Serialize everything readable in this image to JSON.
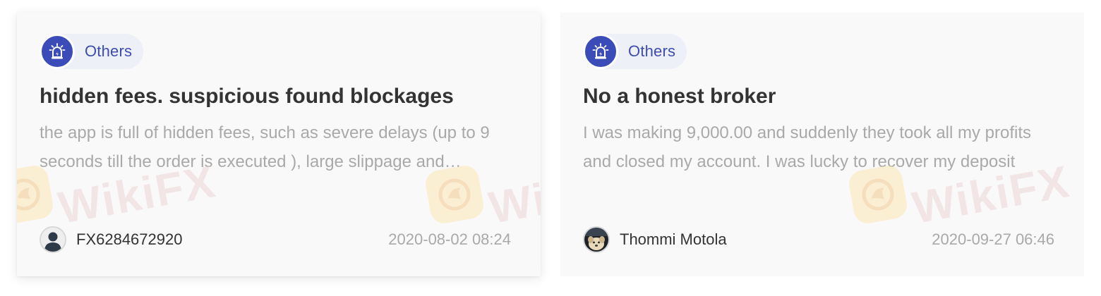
{
  "reviews": [
    {
      "category": "Others",
      "category_icon": "alert-siren-icon",
      "title": "hidden fees. suspicious found blockages",
      "excerpt": "the app is full of hidden fees, such as severe delays (up to 9 seconds till the order is executed ), large slippage and suspicious blockages",
      "author": "FX6284672920",
      "avatar": "default-user-avatar",
      "timestamp": "2020-08-02 08:24"
    },
    {
      "category": "Others",
      "category_icon": "alert-siren-icon",
      "title": "No a honest broker",
      "excerpt": "I was making 9,000.00 and suddenly they took all my profits and closed my account. I was lucky to recover my deposit",
      "author": "Thommi Motola",
      "avatar": "dog-photo-avatar",
      "timestamp": "2020-09-27 06:46"
    }
  ],
  "watermark": {
    "text": "WikiFX"
  },
  "colors": {
    "accent": "#3b4bb8",
    "tag_background": "#eef0f8",
    "title": "#333333",
    "muted_text": "#a9a9a9",
    "card_background": "#f9f9fa"
  }
}
